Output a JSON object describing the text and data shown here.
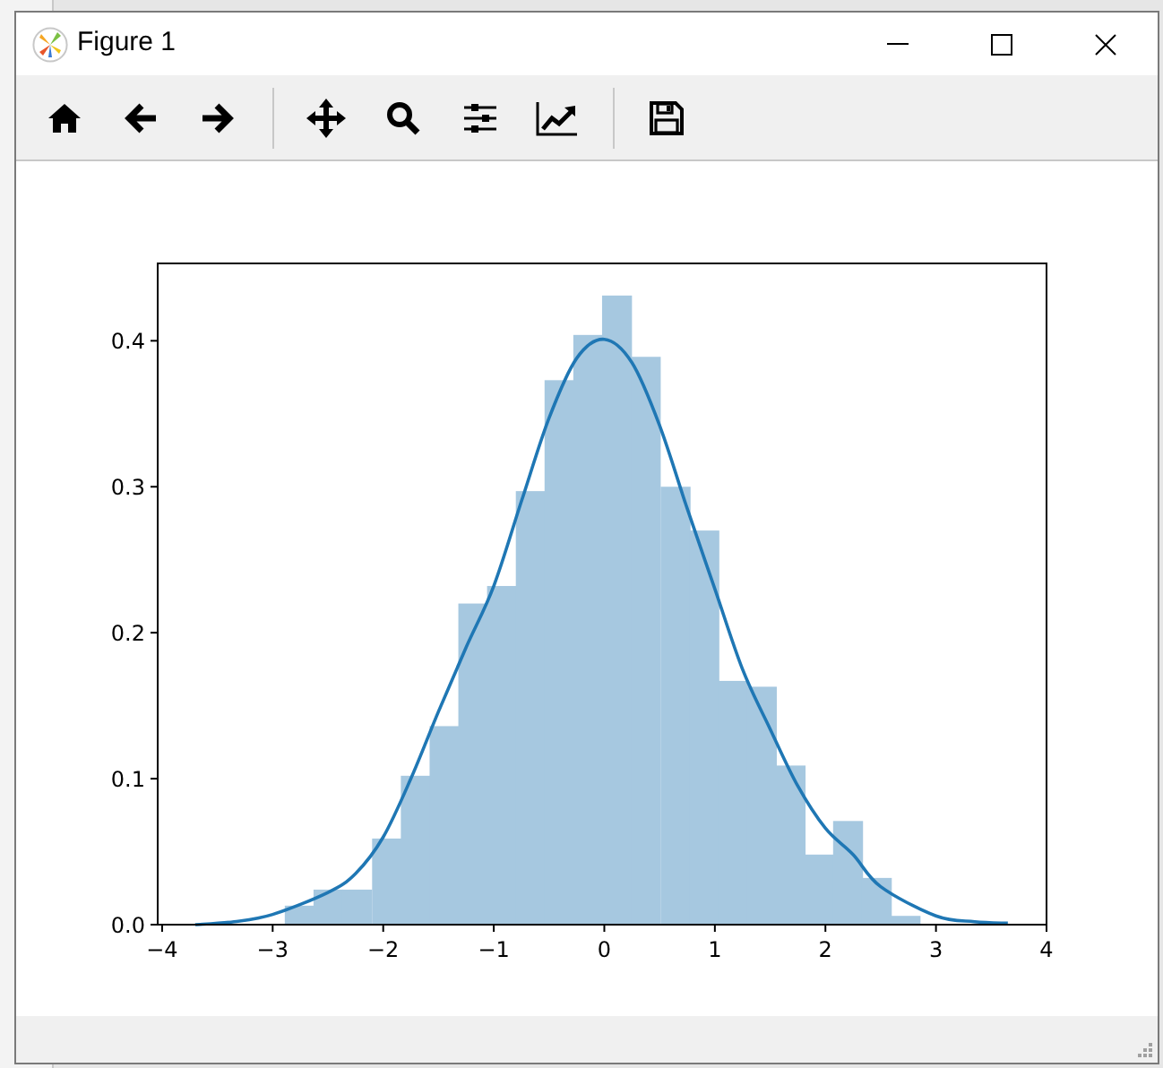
{
  "window": {
    "title": "Figure 1"
  },
  "chart_data": {
    "type": "bar",
    "xlim": [
      -4.04,
      4.0
    ],
    "ylim": [
      0,
      0.453
    ],
    "xticks": [
      {
        "value": -4,
        "label": "−4"
      },
      {
        "value": -3,
        "label": "−3"
      },
      {
        "value": -2,
        "label": "−2"
      },
      {
        "value": -1,
        "label": "−1"
      },
      {
        "value": 0,
        "label": "0"
      },
      {
        "value": 1,
        "label": "1"
      },
      {
        "value": 2,
        "label": "2"
      },
      {
        "value": 3,
        "label": "3"
      },
      {
        "value": 4,
        "label": "4"
      }
    ],
    "yticks": [
      {
        "value": 0,
        "label": "0.0"
      },
      {
        "value": 0.1,
        "label": "0.1"
      },
      {
        "value": 0.2,
        "label": "0.2"
      },
      {
        "value": 0.3,
        "label": "0.3"
      },
      {
        "value": 0.4,
        "label": "0.4"
      }
    ],
    "series": [
      {
        "color": "#a6c8e0",
        "x": [
          -2.76,
          -2.5,
          -2.24,
          -1.97,
          -1.71,
          -1.45,
          -1.19,
          -0.93,
          -0.67,
          -0.41,
          -0.15,
          0.11,
          0.37,
          0.64,
          0.9,
          1.16,
          1.42,
          1.68,
          1.94,
          2.2,
          2.46,
          2.72
        ],
        "values": [
          0.013,
          0.024,
          0.024,
          0.059,
          0.102,
          0.136,
          0.22,
          0.232,
          0.297,
          0.373,
          0.404,
          0.431,
          0.389,
          0.3,
          0.27,
          0.167,
          0.163,
          0.109,
          0.048,
          0.071,
          0.032,
          0.006
        ]
      },
      {
        "type": "line",
        "color": "#1f77b4",
        "x": [
          -3.7,
          -3.35,
          -3,
          -2.5,
          -2.25,
          -2,
          -1.75,
          -1.5,
          -1.25,
          -1,
          -0.75,
          -0.5,
          -0.25,
          0,
          0.25,
          0.5,
          0.75,
          1,
          1.25,
          1.5,
          1.75,
          2,
          2.25,
          2.5,
          3,
          3.35,
          3.65
        ],
        "values": [
          0.0,
          0.002,
          0.007,
          0.022,
          0.035,
          0.06,
          0.1,
          0.146,
          0.19,
          0.232,
          0.29,
          0.347,
          0.388,
          0.401,
          0.385,
          0.342,
          0.285,
          0.23,
          0.175,
          0.134,
          0.095,
          0.066,
          0.048,
          0.026,
          0.006,
          0.002,
          0.001
        ]
      }
    ]
  }
}
